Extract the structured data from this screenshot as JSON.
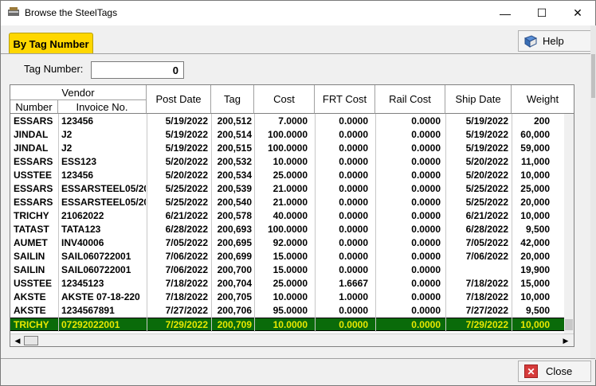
{
  "window": {
    "title": "Browse the SteelTags",
    "minimize": "—",
    "maximize": "☐",
    "close": "✕"
  },
  "tab": {
    "label": "By Tag Number"
  },
  "help": {
    "label": "Help"
  },
  "close_button": {
    "label": "Close"
  },
  "search": {
    "label": "Tag Number:",
    "value": "0"
  },
  "grid": {
    "group_header": "Vendor",
    "headers": {
      "number": "Number",
      "invoice": "Invoice No.",
      "post_date": "Post Date",
      "tag": "Tag",
      "cost": "Cost",
      "frt_cost": "FRT Cost",
      "rail_cost": "Rail Cost",
      "ship_date": "Ship Date",
      "weight": "Weight"
    },
    "rows": [
      [
        "ESSARS",
        "123456",
        "5/19/2022",
        "200,512",
        "7.0000",
        "0.0000",
        "0.0000",
        "5/19/2022",
        "200"
      ],
      [
        "JINDAL",
        "J2",
        "5/19/2022",
        "200,514",
        "100.0000",
        "0.0000",
        "0.0000",
        "5/19/2022",
        "60,000"
      ],
      [
        "JINDAL",
        "J2",
        "5/19/2022",
        "200,515",
        "100.0000",
        "0.0000",
        "0.0000",
        "5/19/2022",
        "59,000"
      ],
      [
        "ESSARS",
        "ESS123",
        "5/20/2022",
        "200,532",
        "10.0000",
        "0.0000",
        "0.0000",
        "5/20/2022",
        "11,000"
      ],
      [
        "USSTEE",
        "123456",
        "5/20/2022",
        "200,534",
        "25.0000",
        "0.0000",
        "0.0000",
        "5/20/2022",
        "10,000"
      ],
      [
        "ESSARS",
        "ESSARSTEEL05/20",
        "5/25/2022",
        "200,539",
        "21.0000",
        "0.0000",
        "0.0000",
        "5/25/2022",
        "25,000"
      ],
      [
        "ESSARS",
        "ESSARSTEEL05/20",
        "5/25/2022",
        "200,540",
        "21.0000",
        "0.0000",
        "0.0000",
        "5/25/2022",
        "20,000"
      ],
      [
        "TRICHY",
        "21062022",
        "6/21/2022",
        "200,578",
        "40.0000",
        "0.0000",
        "0.0000",
        "6/21/2022",
        "10,000"
      ],
      [
        "TATAST",
        "TATA123",
        "6/28/2022",
        "200,693",
        "100.0000",
        "0.0000",
        "0.0000",
        "6/28/2022",
        "9,500"
      ],
      [
        "AUMET",
        "INV40006",
        "7/05/2022",
        "200,695",
        "92.0000",
        "0.0000",
        "0.0000",
        "7/05/2022",
        "42,000"
      ],
      [
        "SAILIN",
        "SAIL060722001",
        "7/06/2022",
        "200,699",
        "15.0000",
        "0.0000",
        "0.0000",
        "7/06/2022",
        "20,000"
      ],
      [
        "SAILIN",
        "SAIL060722001",
        "7/06/2022",
        "200,700",
        "15.0000",
        "0.0000",
        "0.0000",
        "",
        "19,900"
      ],
      [
        "USSTEE",
        "12345123",
        "7/18/2022",
        "200,704",
        "25.0000",
        "1.6667",
        "0.0000",
        "7/18/2022",
        "15,000"
      ],
      [
        "AKSTE",
        "AKSTE 07-18-220",
        "7/18/2022",
        "200,705",
        "10.0000",
        "1.0000",
        "0.0000",
        "7/18/2022",
        "10,000"
      ],
      [
        "AKSTE",
        "1234567891",
        "7/27/2022",
        "200,706",
        "95.0000",
        "0.0000",
        "0.0000",
        "7/27/2022",
        "9,500"
      ],
      [
        "TRICHY",
        "07292022001",
        "7/29/2022",
        "200,709",
        "10.0000",
        "0.0000",
        "0.0000",
        "7/29/2022",
        "10,000"
      ]
    ],
    "selected_index": 15
  },
  "colors": {
    "tab": "#ffd700",
    "selection_bg": "#0a6b0a",
    "selection_text": "#e8e800",
    "close_icon": "#d63b3b"
  }
}
